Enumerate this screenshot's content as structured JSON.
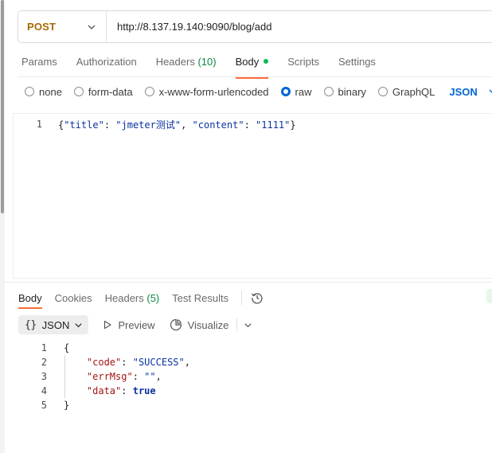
{
  "request": {
    "method": "POST",
    "url": "http://8.137.19.140:9090/blog/add"
  },
  "request_tabs": [
    {
      "label": "Params"
    },
    {
      "label": "Authorization"
    },
    {
      "label": "Headers",
      "count": "(10)"
    },
    {
      "label": "Body"
    },
    {
      "label": "Scripts"
    },
    {
      "label": "Settings"
    }
  ],
  "body_types": [
    {
      "label": "none",
      "selected": false
    },
    {
      "label": "form-data",
      "selected": false
    },
    {
      "label": "x-www-form-urlencoded",
      "selected": false
    },
    {
      "label": "raw",
      "selected": true
    },
    {
      "label": "binary",
      "selected": false
    },
    {
      "label": "GraphQL",
      "selected": false
    }
  ],
  "body_language": "JSON",
  "request_body": {
    "line_number": "1",
    "key1": "\"title\"",
    "value1": "\"jmeter测试\"",
    "key2": "\"content\"",
    "value2": "\"1111\""
  },
  "response_tabs": [
    {
      "label": "Body"
    },
    {
      "label": "Cookies"
    },
    {
      "label": "Headers",
      "count": "(5)"
    },
    {
      "label": "Test Results"
    }
  ],
  "response_toolbar": {
    "format_braces": "{}",
    "format_label": "JSON",
    "preview_label": "Preview",
    "visualize_label": "Visualize"
  },
  "response_body": {
    "lines": [
      "1",
      "2",
      "3",
      "4",
      "5"
    ],
    "open_brace": "{",
    "close_brace": "}",
    "code_key": "\"code\"",
    "code_value": "\"SUCCESS\"",
    "errmsg_key": "\"errMsg\"",
    "errmsg_value": "\"\"",
    "data_key": "\"data\"",
    "data_value": "true"
  },
  "colors": {
    "method": "#a76a00",
    "accent": "#ff6c37",
    "selected_radio": "#0265d2",
    "status_dot": "#0cbb52"
  }
}
